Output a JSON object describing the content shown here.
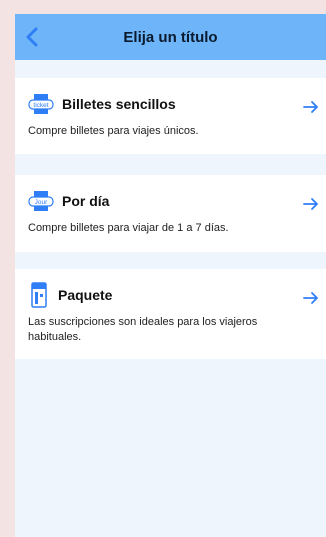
{
  "header": {
    "title": "Elija un título"
  },
  "colors": {
    "accent": "#2f7ef5",
    "header_bg": "#6db5f8",
    "page_bg": "#eef5fd"
  },
  "options": [
    {
      "title": "Billetes sencillos",
      "description": "Compre billetes para viajes únicos.",
      "icon": "ticket-icon",
      "icon_label": "ticket"
    },
    {
      "title": "Por día",
      "description": "Compre billetes para viajar de 1 a 7 días.",
      "icon": "day-ticket-icon",
      "icon_label": "Jour"
    },
    {
      "title": "Paquete",
      "description": "Las suscripciones son ideales para los viajeros habituales.",
      "icon": "subscription-card-icon",
      "icon_label": ""
    }
  ]
}
